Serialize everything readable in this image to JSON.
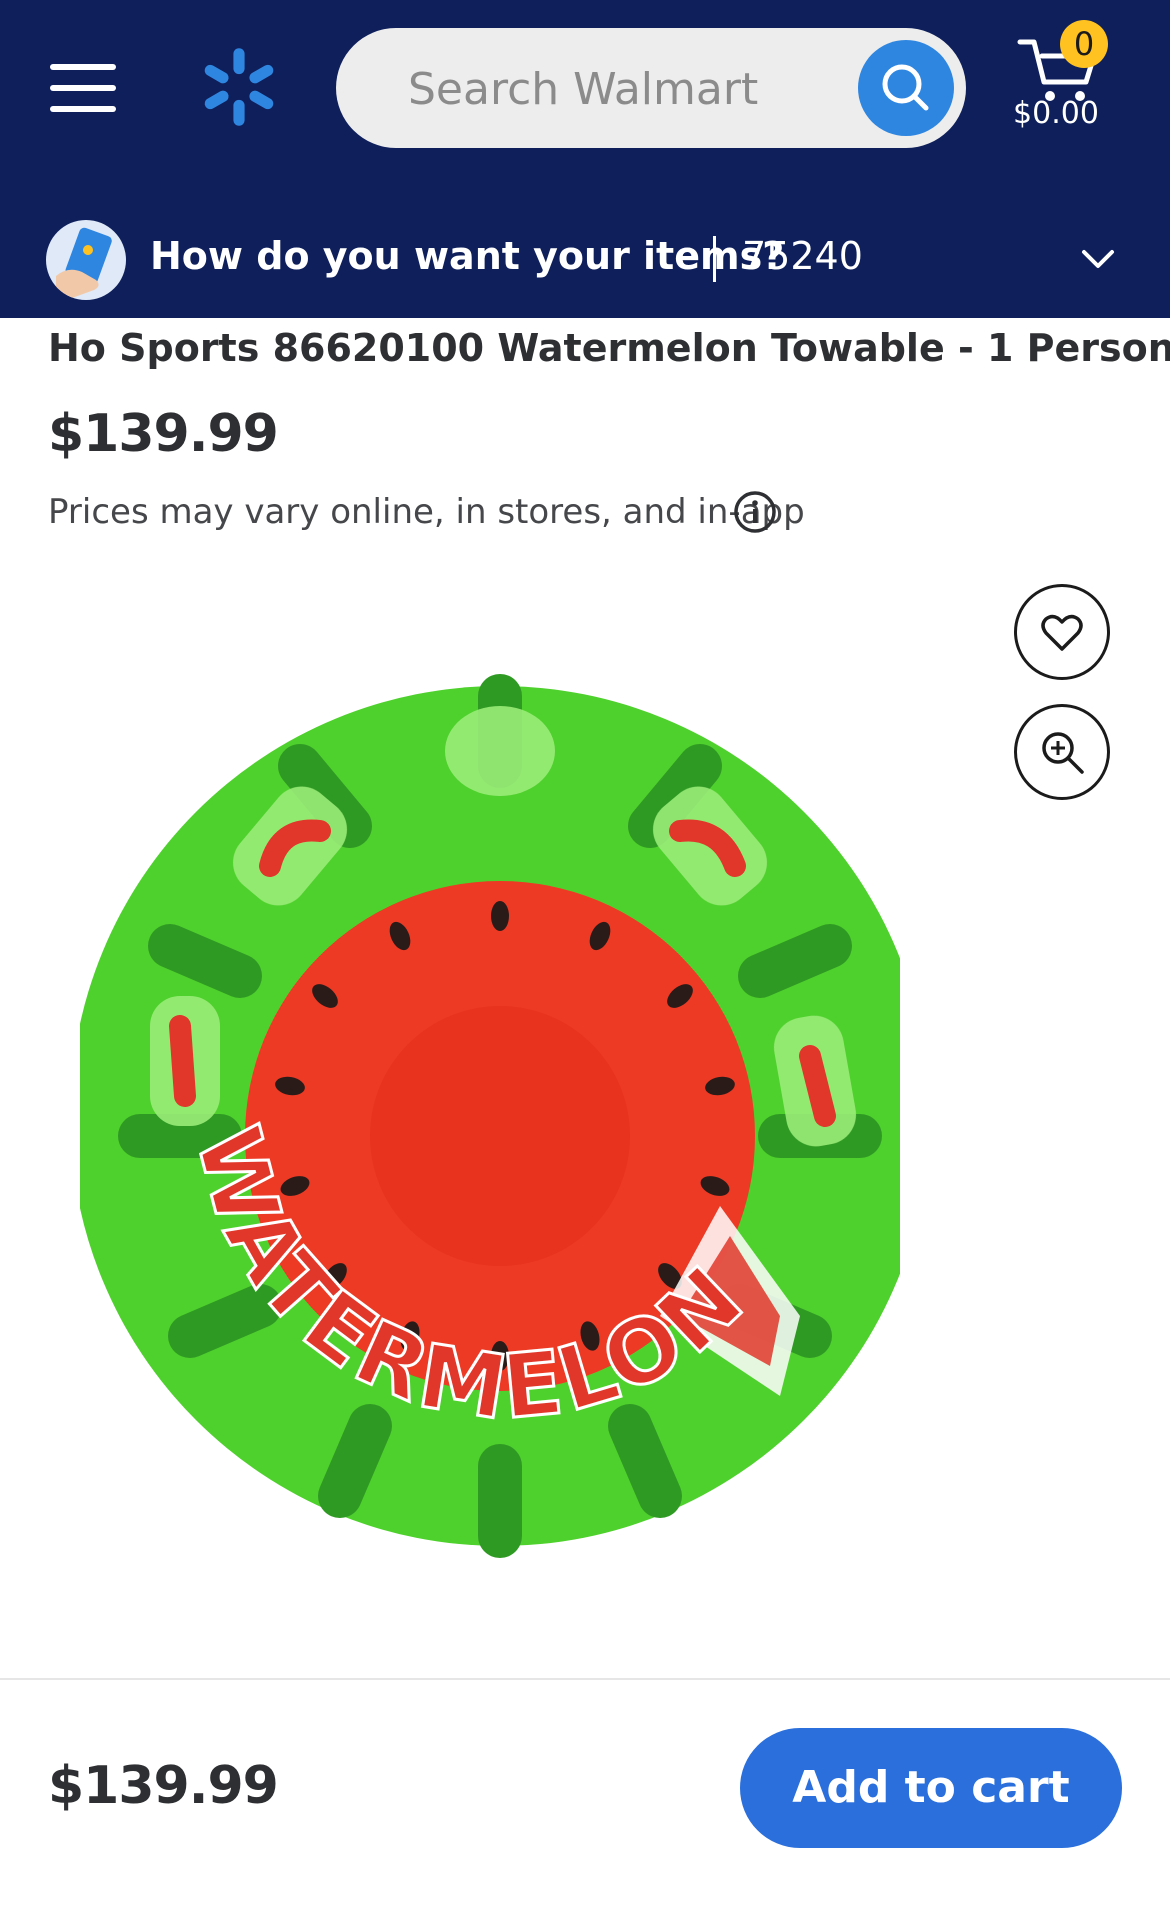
{
  "header": {
    "search_placeholder": "Search Walmart",
    "cart_count": "0",
    "cart_total": "$0.00"
  },
  "fulfillment": {
    "question": "How do you want your items?",
    "zip": "75240"
  },
  "product": {
    "title": "Ho Sports 86620100 Watermelon Towable - 1 Person",
    "price": "$139.99",
    "price_note": "Prices may vary online, in stores, and in-app",
    "image_text": "WATERMELON"
  },
  "bottom_bar": {
    "price": "$139.99",
    "add_to_cart_label": "Add to cart"
  },
  "icons": {
    "menu": "hamburger-menu-icon",
    "logo": "walmart-spark-icon",
    "search": "search-icon",
    "cart": "cart-icon",
    "fulfillment": "phone-hand-icon",
    "chevron": "chevron-down-icon",
    "info": "info-icon",
    "favorite": "heart-icon",
    "zoom": "zoom-in-icon"
  },
  "colors": {
    "header_bg": "#0e1f5b",
    "spark": "#2f86e0",
    "search_button": "#2f86e0",
    "cart_badge": "#ffc220",
    "primary_button": "#2a6fdb",
    "text": "#2e2f32"
  }
}
